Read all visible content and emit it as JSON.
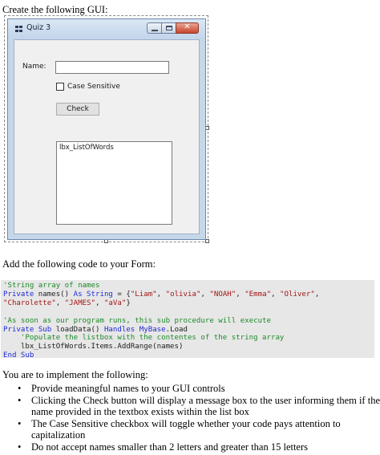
{
  "intro_text": "Create the following GUI:",
  "window": {
    "title": "Quiz 3",
    "close_glyph": "✕",
    "name_label": "Name:",
    "name_value": "",
    "checkbox_label": "Case Sensitive",
    "checkbox_checked": false,
    "button_label": "Check",
    "listbox_text": "lbx_ListOfWords"
  },
  "code_intro": "Add the following code to your Form:",
  "code": {
    "line1": "'String array of names",
    "line2_kw1": "Private",
    "line2_a": " names() ",
    "line2_kw2": "As",
    "line2_b": " ",
    "line2_kw3": "String",
    "line2_c": " = {",
    "line2_s1": "\"Liam\"",
    "line2_s2": "\"olivia\"",
    "line2_s3": "\"NOAH\"",
    "line2_s4": "\"Emma\"",
    "line2_s5": "\"Oliver\"",
    "line3_s6": "\"Charolette\"",
    "line3_s7": "\"JAMES\"",
    "line3_s8": "\"aVa\"",
    "line5": "'As soon as our program runs, this sub procedure will execute",
    "line6_kw1": "Private",
    "line6_kw2": "Sub",
    "line6_a": " loadData() ",
    "line6_kw3": "Handles",
    "line6_kw4": "MyBase",
    "line6_b": ".Load",
    "line7": "    'Populate the listbox with the contentes of the string array",
    "line8": "    lbx_ListOfWords.Items.AddRange(names)",
    "line9_kw1": "End",
    "line9_kw2": "Sub"
  },
  "tasks_intro": "You are to implement the following:",
  "tasks": [
    "Provide meaningful names to your GUI controls",
    "Clicking the Check button will display a message box to the user informing them if the name provided in the textbox exists within the list box",
    "The Case Sensitive checkbox will toggle whether your code pays attention to capitalization",
    "Do not accept names smaller than 2 letters and greater than 15 letters"
  ]
}
